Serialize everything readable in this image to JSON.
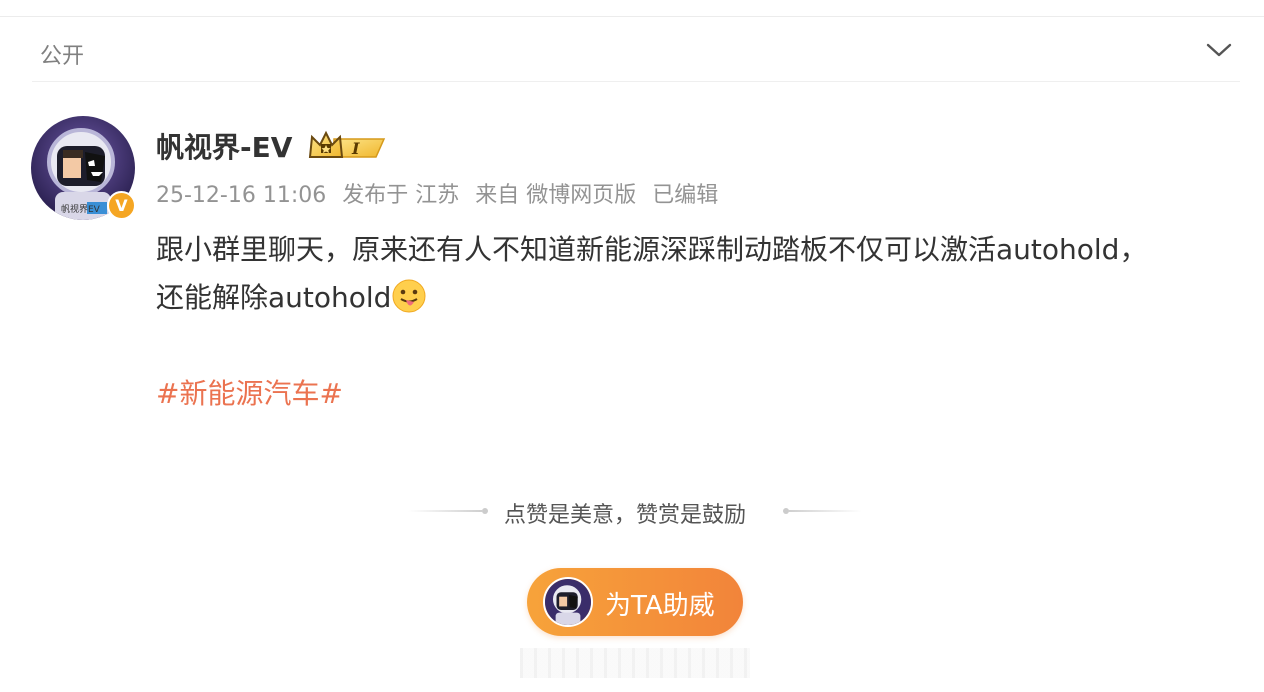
{
  "visibility": {
    "label": "公开"
  },
  "post": {
    "author": "帆视界-EV",
    "avatar_badge_text": "帆视界EV",
    "verified_badge": "V",
    "level_badge_text": "I",
    "meta": {
      "time": "25-12-16 11:06",
      "location": "发布于 江苏",
      "source": "来自 微博网页版",
      "edited": "已编辑"
    },
    "content_line1": "跟小群里聊天，原来还有人不知道新能源深踩制动踏板不仅可以激活autohold，",
    "content_line2": "还能解除autohold",
    "emoji": "lick-tongue-emoji",
    "hashtag": "#新能源汽车#"
  },
  "reward": {
    "text": "点赞是美意，赞赏是鼓励",
    "button_label": "为TA助威"
  },
  "icons": [
    "chevron-down-icon",
    "crown-icon",
    "verified-icon"
  ],
  "colors": {
    "hashtag": "#eb7350",
    "button_start": "#f7a33a",
    "button_end": "#f2843a",
    "verified": "#f5a623"
  }
}
